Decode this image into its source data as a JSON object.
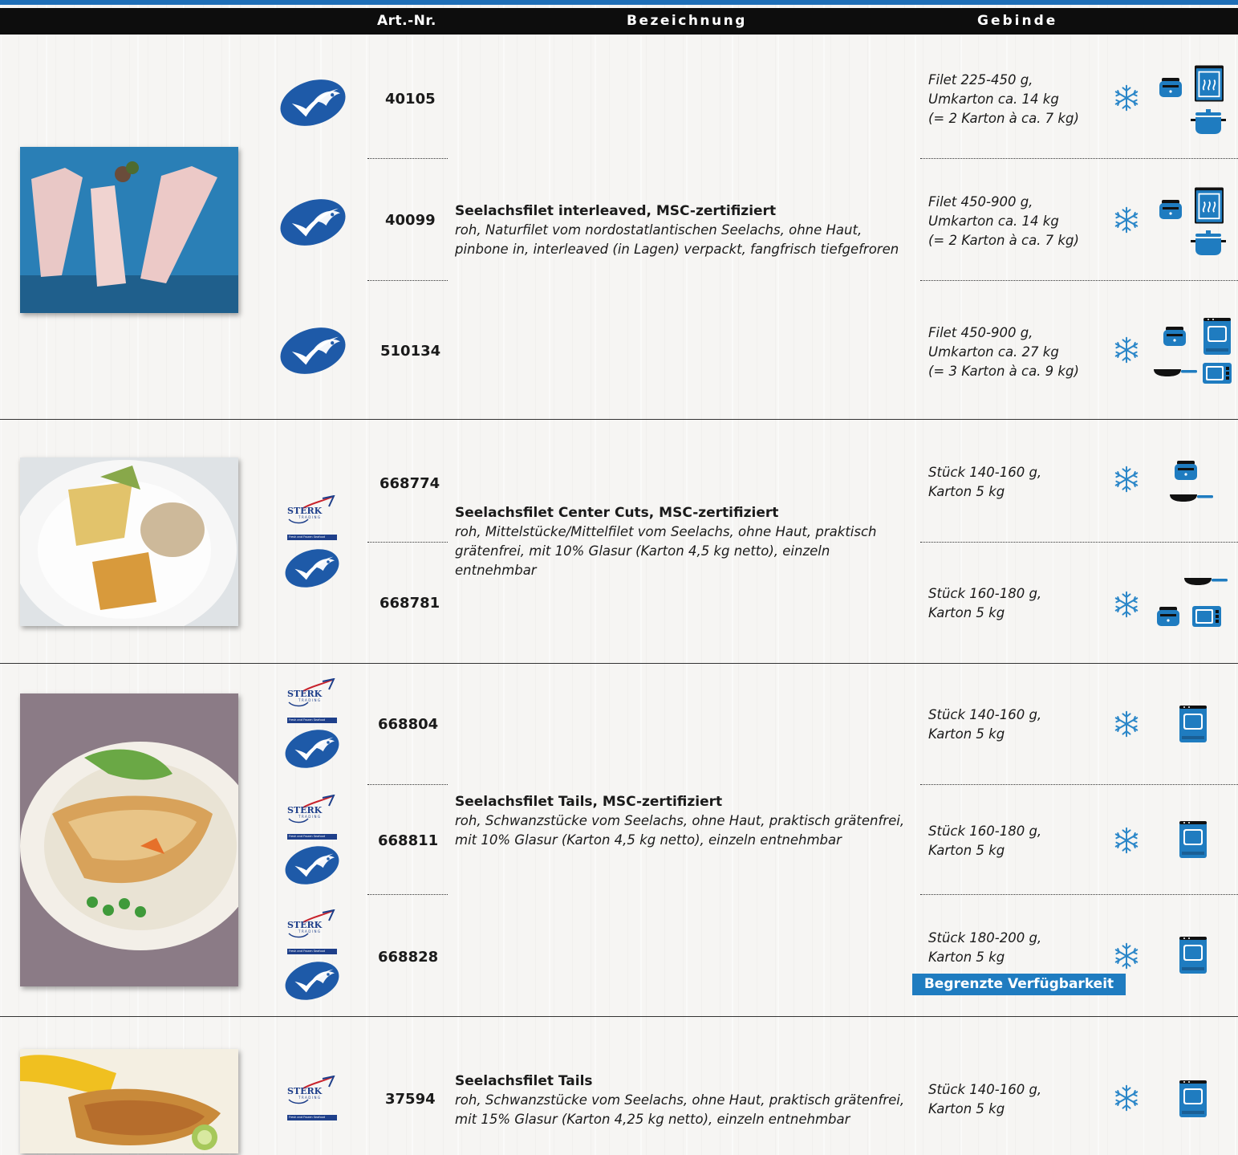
{
  "header": {
    "art_nr": "Art.-Nr.",
    "bezeichnung": "Bezeichnung",
    "gebinde": "Gebinde"
  },
  "logos": {
    "sterk_name": "STERK",
    "sterk_sub": "TRADING",
    "sterk_tagline": "Fresh and Frozen Seafood"
  },
  "colors": {
    "accent_blue": "#1f7cc0",
    "header_black": "#0d0d0d",
    "msc_blue": "#1e5aa8"
  },
  "groups": [
    {
      "title": "Seelachsfilet interleaved, MSC-zertifiziert",
      "description": "roh, Naturfilet vom nordostatlantischen Seelachs, ohne Haut, pinbone in, interleaved (in Lagen) verpackt, fangfrisch tiefgefroren",
      "items": [
        {
          "art_nr": "40105",
          "gebinde": "Filet 225-450 g,\nUmkarton ca. 14 kg\n(= 2 Karton à ca. 7 kg)",
          "icons": [
            "snowflake-icon",
            "fryer-icon",
            "steamer-icon",
            "pot-icon"
          ]
        },
        {
          "art_nr": "40099",
          "gebinde": "Filet 450-900 g,\nUmkarton ca. 14 kg\n(= 2 Karton à ca. 7 kg)",
          "icons": [
            "snowflake-icon",
            "fryer-icon",
            "steamer-icon",
            "pot-icon"
          ]
        },
        {
          "art_nr": "510134",
          "gebinde": "Filet 450-900 g,\nUmkarton ca. 27 kg\n(= 3 Karton à ca. 9 kg)",
          "icons": [
            "snowflake-icon",
            "fryer-icon",
            "oven-icon",
            "pan-icon",
            "microwave-icon"
          ]
        }
      ]
    },
    {
      "title": "Seelachsfilet Center Cuts, MSC-zertifiziert",
      "description": "roh, Mittelstücke/Mittelfilet vom Seelachs, ohne Haut, praktisch grätenfrei, mit 10% Glasur (Karton 4,5 kg netto), einzeln entnehmbar",
      "items": [
        {
          "art_nr": "668774",
          "gebinde": "Stück 140-160 g,\nKarton 5 kg",
          "icons": [
            "snowflake-icon",
            "fryer-icon",
            "pan-icon"
          ]
        },
        {
          "art_nr": "668781",
          "gebinde": "Stück 160-180 g,\nKarton 5 kg",
          "icons": [
            "snowflake-icon",
            "pan-icon",
            "fryer-icon",
            "microwave-icon"
          ]
        }
      ]
    },
    {
      "title": "Seelachsfilet Tails, MSC-zertifiziert",
      "description": "roh, Schwanzstücke vom Seelachs, ohne Haut, praktisch grätenfrei, mit 10% Glasur (Karton 4,5 kg netto), einzeln entnehmbar",
      "items": [
        {
          "art_nr": "668804",
          "gebinde": "Stück 140-160 g,\nKarton 5 kg",
          "icons": [
            "snowflake-icon",
            "oven-icon"
          ]
        },
        {
          "art_nr": "668811",
          "gebinde": "Stück 160-180 g,\nKarton 5 kg",
          "icons": [
            "snowflake-icon",
            "oven-icon"
          ]
        },
        {
          "art_nr": "668828",
          "gebinde": "Stück 180-200 g,\nKarton 5 kg",
          "icons": [
            "snowflake-icon",
            "oven-icon"
          ],
          "badge": "Begrenzte Verfügbarkeit"
        }
      ]
    },
    {
      "title": "Seelachsfilet Tails",
      "description": "roh, Schwanzstücke vom Seelachs, ohne Haut, praktisch grätenfrei, mit 15% Glasur (Karton 4,25 kg netto), einzeln entnehmbar",
      "items": [
        {
          "art_nr": "37594",
          "gebinde": "Stück 140-160 g,\nKarton 5 kg",
          "icons": [
            "snowflake-icon",
            "oven-icon"
          ]
        }
      ]
    }
  ]
}
